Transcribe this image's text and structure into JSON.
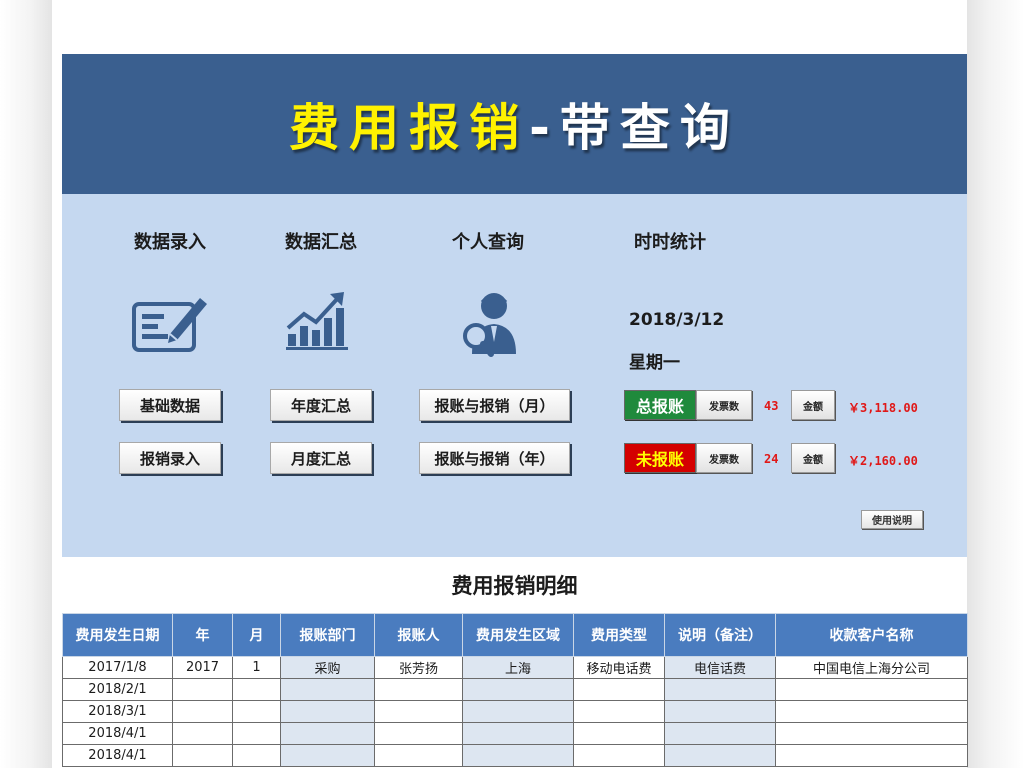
{
  "banner": {
    "title_part1": "费用报销",
    "title_part2": "-带查询",
    "color_bg": "#3a5f8f",
    "color_accent": "#fff200"
  },
  "nav": {
    "headings": [
      "数据录入",
      "数据汇总",
      "个人查询",
      "时时统计"
    ],
    "icons": [
      "form-edit-icon",
      "growth-chart-icon",
      "person-search-icon"
    ],
    "buttons": {
      "basic_data": "基础数据",
      "expense_entry": "报销录入",
      "annual_summary": "年度汇总",
      "monthly_summary": "月度汇总",
      "claim_month": "报账与报销（月）",
      "claim_year": "报账与报销（年）"
    }
  },
  "stats": {
    "date": "2018/3/12",
    "weekday": "星期一",
    "total": {
      "label": "总报账",
      "invoice_label": "发票数",
      "invoice_count": "43",
      "amount_label": "金额",
      "amount": "￥3,118.00",
      "color": "#1f8a3c"
    },
    "unpaid": {
      "label": "未报账",
      "invoice_label": "发票数",
      "invoice_count": "24",
      "amount_label": "金额",
      "amount": "￥2,160.00",
      "color": "#d40000"
    },
    "help_label": "使用说明"
  },
  "detail": {
    "title": "费用报销明细",
    "columns": [
      "费用发生日期",
      "年",
      "月",
      "报账部门",
      "报账人",
      "费用发生区域",
      "费用类型",
      "说明（备注）",
      "收款客户名称"
    ],
    "rows": [
      [
        "2017/1/8",
        "2017",
        "1",
        "采购",
        "张芳扬",
        "上海",
        "移动电话费",
        "电信话费",
        "中国电信上海分公司"
      ],
      [
        "2018/2/1",
        "",
        "",
        "",
        "",
        "",
        "",
        "",
        ""
      ],
      [
        "2018/3/1",
        "",
        "",
        "",
        "",
        "",
        "",
        "",
        ""
      ],
      [
        "2018/4/1",
        "",
        "",
        "",
        "",
        "",
        "",
        "",
        ""
      ],
      [
        "2018/4/1",
        "",
        "",
        "",
        "",
        "",
        "",
        "",
        ""
      ]
    ]
  }
}
